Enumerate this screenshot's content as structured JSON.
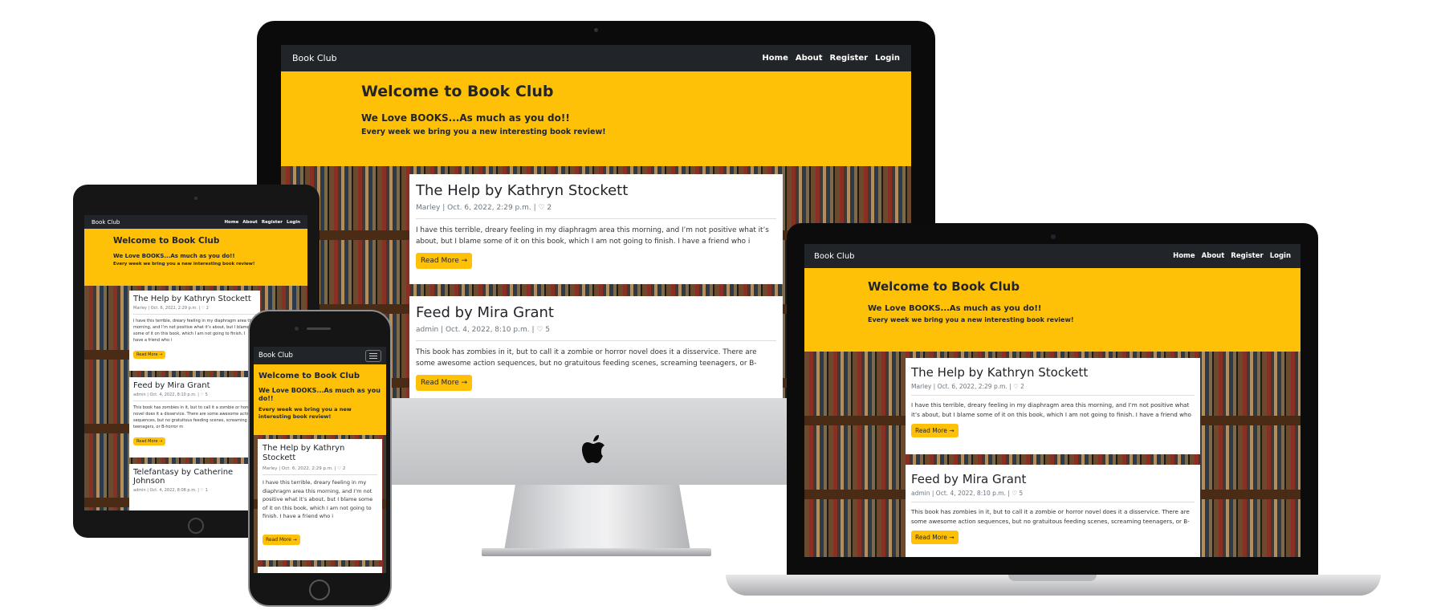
{
  "site": {
    "brand": "Book Club",
    "nav": [
      "Home",
      "About",
      "Register",
      "Login"
    ],
    "hero_title": "Welcome to Book Club",
    "hero_subtitle": "We Love BOOKS...As much as you do!!",
    "hero_tagline": "Every week we bring you a new interesting book review!",
    "read_more": "Read More →"
  },
  "posts": [
    {
      "title": "The Help by Kathryn Stockett",
      "meta": "Marley | Oct. 6, 2022, 2:29 p.m. | ♡ 2",
      "excerpt": "I have this terrible, dreary feeling in my diaphragm area this morning, and I’m not positive what it’s about, but I blame some of it on this book, which I am not going to finish. I have a friend who i"
    },
    {
      "title": "Feed by Mira Grant",
      "meta": "admin | Oct. 4, 2022, 8:10 p.m. | ♡ 5",
      "excerpt": "This book has zombies in it, but to call it a zombie or horror novel does it a disservice. There are some awesome action sequences, but no gratuitous feeding scenes, screaming teenagers, or B-horror m"
    },
    {
      "title": "Telefantasy by Catherine Johnson",
      "meta": "admin | Oct. 4, 2022, 8:08 p.m. | ♡ 1",
      "excerpt": ""
    }
  ],
  "apple_logo_icon": "apple-logo"
}
